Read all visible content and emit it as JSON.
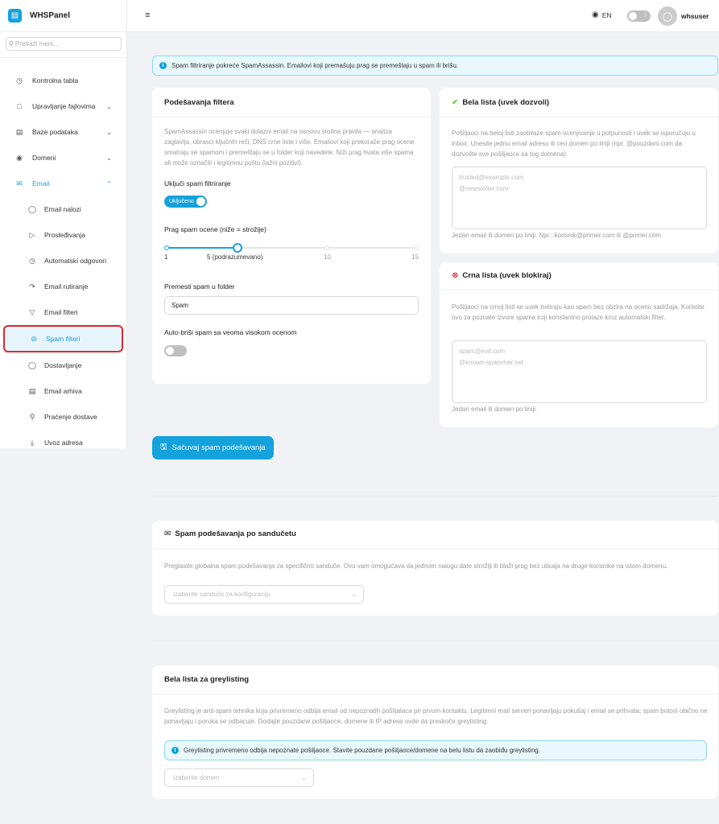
{
  "brand": {
    "name": "WHSPanel",
    "logo_icon": "server-icon"
  },
  "sidebar": {
    "search_placeholder": "Pretraži meni...",
    "items": [
      {
        "label": "Kontrolna tabla",
        "icon": "dashboard-icon"
      },
      {
        "label": "Upravljanje fajlovima",
        "icon": "folder-icon"
      },
      {
        "label": "Baze podataka",
        "icon": "database-icon"
      },
      {
        "label": "Domeni",
        "icon": "globe-icon"
      },
      {
        "label": "Email",
        "icon": "mail-icon"
      },
      {
        "label": "Email nalozi",
        "icon": "user-icon"
      },
      {
        "label": "Prosleđivanja",
        "icon": "send-icon"
      },
      {
        "label": "Automatski odgovori",
        "icon": "clock-icon"
      },
      {
        "label": "Email rutiranje",
        "icon": "route-icon"
      },
      {
        "label": "Email filteri",
        "icon": "filter-icon"
      },
      {
        "label": "Spam filteri",
        "icon": "ban-icon"
      },
      {
        "label": "Dostavljanje",
        "icon": "shield-icon"
      },
      {
        "label": "Email arhiva",
        "icon": "archive-icon"
      },
      {
        "label": "Praćenje dostave",
        "icon": "search-icon"
      },
      {
        "label": "Uvoz adresa",
        "icon": "import-icon"
      }
    ]
  },
  "header": {
    "language": "EN",
    "username": "whsuser"
  },
  "info_banner": "Spam filtriranje pokreće SpamAssassin. Emailovi koji premašuju prag se premeštaju u spam ili brišu.",
  "filter_settings": {
    "title": "Podešavanja filtera",
    "description": "SpamAssassin ocenjuje svaki dolazni email na osnovu stotina pravila — analiza zaglavlja, obrasci ključnih reči, DNS crne liste i više. Emailovi koji prekorače prag ocene smatraju se spamom i premeštaju se u folder koji navedete. Niži prag hvata više spama ali može označiti i legitimnu poštu (lažni pozitivi).",
    "enable_label": "Uključi spam filtriranje",
    "enable_value": "Uključeno",
    "threshold_label": "Prag spam ocene (niže = strožije)",
    "threshold_value": 5,
    "threshold_min": 1,
    "threshold_max": 15,
    "marks": {
      "min": "1",
      "default": "5 (podrazumevano)",
      "mid": "10",
      "max": "15"
    },
    "folder_label": "Premesti spam u folder",
    "folder_value": "Spam",
    "autodelete_label": "Auto-briši spam sa veoma visokom ocenom"
  },
  "whitelist": {
    "title": "Bela lista (uvek dozvoli)",
    "description": "Pošiljaoci na beloj listi zaobilaze spam ocenjivanje u potpunosti i uvek se isporučuju u inbox. Unesite jednu email adresu ili ceo domen po liniji (npr. @pouzdani.com da dozvolite sve pošiljaoce sa tog domena).",
    "placeholder_line1": "trusted@example.com",
    "placeholder_line2": "@newsletter.com",
    "hint": "Jedan email ili domen po liniji. Npr.: korisnik@primer.com ili @primer.com"
  },
  "blacklist": {
    "title": "Crna lista (uvek blokiraj)",
    "description": "Pošiljaoci na crnoj listi se uvek tretiraju kao spam bez obzira na ocenu sadržaja. Koristite ovo za poznate izvore spama koji konstantno prolaze kroz automatski filter.",
    "placeholder_line1": "spam@evil.com",
    "placeholder_line2": "@known-spammer.net",
    "hint": "Jedan email ili domen po liniji."
  },
  "save_button": "Sačuvaj spam podešavanja",
  "per_mailbox": {
    "title": "Spam podešavanja po sandučetu",
    "description": "Preglasite globalna spam podešavanja za specifično sanduče. Ovo vam omogućava da jednom nalogu date strožiji ili blaži prag bez uticaja na druge korisnike na istom domenu.",
    "select_placeholder": "Izaberite sanduče za konfiguraciju"
  },
  "greylisting": {
    "title": "Bela lista za greylisting",
    "description": "Greylisting je anti-spam tehnika koja privremeno odbija email od nepoznatih pošiljalaca pri prvom kontaktu. Legitimni mail serveri ponavljaju pokušaj i email se prihvata; spam botovi obično ne ponavljaju i poruka se odbacuje. Dodajte pouzdane pošiljaoce, domene ili IP adrese ovde da preskoče greylisting.",
    "notice": "Greylisting privremeno odbija nepoznate pošiljaoce. Stavite pouzdane pošiljaoce/domene na belu listu da zaobiđu greylisting.",
    "select_placeholder": "Izaberite domen"
  }
}
